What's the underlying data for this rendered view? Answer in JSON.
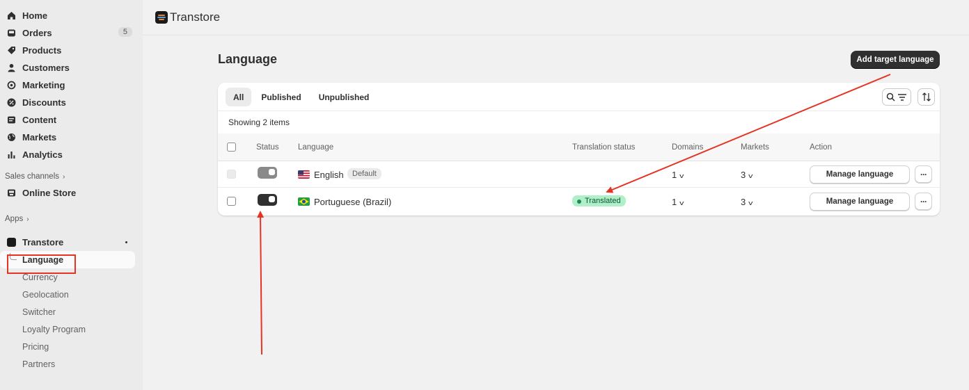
{
  "sidebar": {
    "items": [
      {
        "label": "Home",
        "icon": "home-icon"
      },
      {
        "label": "Orders",
        "icon": "inbox-icon",
        "badge": "5"
      },
      {
        "label": "Products",
        "icon": "tag-icon"
      },
      {
        "label": "Customers",
        "icon": "person-icon"
      },
      {
        "label": "Marketing",
        "icon": "target-icon"
      },
      {
        "label": "Discounts",
        "icon": "discount-icon"
      },
      {
        "label": "Content",
        "icon": "image-icon"
      },
      {
        "label": "Markets",
        "icon": "globe-icon"
      },
      {
        "label": "Analytics",
        "icon": "bar-chart-icon"
      }
    ],
    "sales_channels_label": "Sales channels",
    "online_store_label": "Online Store",
    "apps_label": "Apps",
    "app_name": "Transtore",
    "app_subitems": [
      "Language",
      "Currency",
      "Geolocation",
      "Switcher",
      "Loyalty Program",
      "Pricing",
      "Partners"
    ]
  },
  "topbar": {
    "title": "Transtore"
  },
  "page": {
    "title": "Language",
    "add_button": "Add target language",
    "tabs": [
      "All",
      "Published",
      "Unpublished"
    ],
    "showing": "Showing 2 items",
    "columns": [
      "Status",
      "Language",
      "Translation status",
      "Domains",
      "Markets",
      "Action"
    ],
    "rows": [
      {
        "language": "English",
        "flag": "us-flag",
        "default_badge": "Default",
        "status": "off",
        "translation_status": "",
        "domains": "1",
        "markets": "3",
        "action": "Manage language"
      },
      {
        "language": "Portuguese (Brazil)",
        "flag": "brazil-flag",
        "default_badge": "",
        "status": "on",
        "translation_status": "Translated",
        "domains": "1",
        "markets": "3",
        "action": "Manage language"
      }
    ]
  },
  "colors": {
    "annotation": "#e53423",
    "primary": "#303030",
    "success_bg": "#aff0c8"
  }
}
